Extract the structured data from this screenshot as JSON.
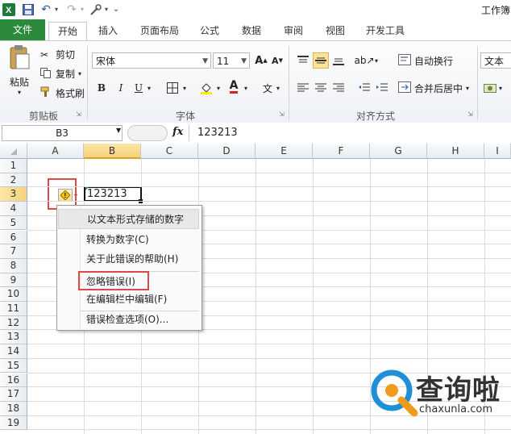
{
  "titlebar": {
    "app_title": "工作簿"
  },
  "tabs": [
    {
      "label": "文件"
    },
    {
      "label": "开始"
    },
    {
      "label": "插入"
    },
    {
      "label": "页面布局"
    },
    {
      "label": "公式"
    },
    {
      "label": "数据"
    },
    {
      "label": "审阅"
    },
    {
      "label": "视图"
    },
    {
      "label": "开发工具"
    }
  ],
  "clipboard": {
    "paste_label": "粘贴",
    "cut_label": "剪切",
    "copy_label": "复制",
    "format_painter_label": "格式刷",
    "group_label": "剪贴板"
  },
  "font": {
    "name": "宋体",
    "size": "11",
    "group_label": "字体",
    "bold": "B",
    "italic": "I",
    "underline": "U"
  },
  "alignment": {
    "wrap_label": "自动换行",
    "merge_label": "合并后居中",
    "group_label": "对齐方式"
  },
  "number": {
    "format": "文本"
  },
  "formula_bar": {
    "name_box": "B3",
    "fx": "fx",
    "content": "123213"
  },
  "grid": {
    "columns": [
      "A",
      "B",
      "C",
      "D",
      "E",
      "F",
      "G",
      "H",
      "I"
    ],
    "rows": [
      "1",
      "2",
      "3",
      "4",
      "5",
      "6",
      "7",
      "8",
      "9",
      "10",
      "11",
      "12",
      "13",
      "14",
      "15",
      "16",
      "17",
      "18",
      "19"
    ],
    "cell_b3": "123213"
  },
  "context_menu": {
    "items": [
      {
        "label": "以文本形式存储的数字"
      },
      {
        "label": "转换为数字(C)"
      },
      {
        "label": "关于此错误的帮助(H)"
      },
      {
        "label": "忽略错误(I)"
      },
      {
        "label": "在编辑栏中编辑(F)"
      },
      {
        "label": "错误检查选项(O)..."
      }
    ]
  },
  "watermark": {
    "brand": "查询啦",
    "url": "chaxunla.com"
  },
  "colors": {
    "file_tab": "#2c8a3c",
    "highlight": "#e04848",
    "selected_col": "#f7d88c"
  }
}
